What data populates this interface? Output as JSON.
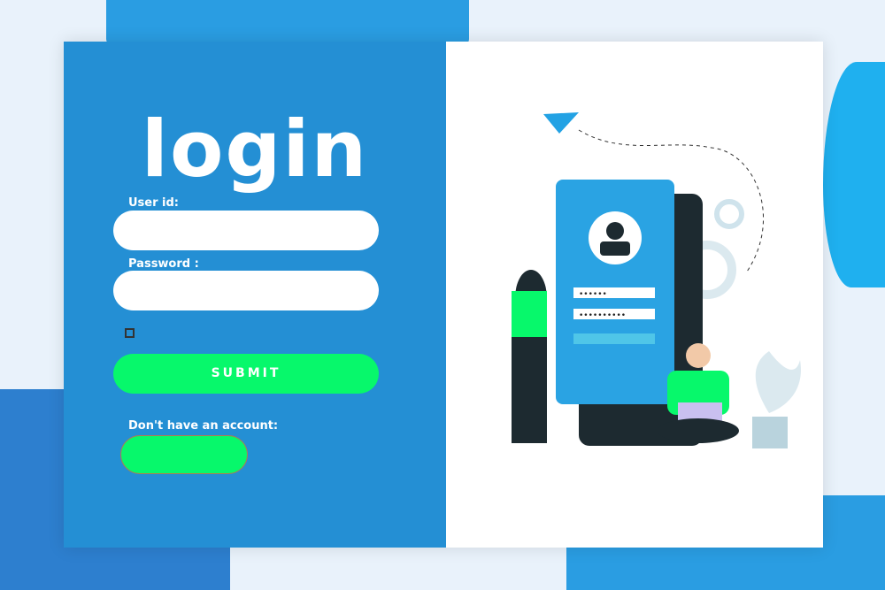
{
  "title": "login",
  "form": {
    "user_label": "User id:",
    "user_value": "",
    "password_label": "Password :",
    "password_value": "",
    "submit_label": "SUBMIT",
    "no_account_label": "Don't have an account:"
  },
  "illustration": {
    "masked_short": "••••••",
    "masked_long": "••••••••••"
  },
  "colors": {
    "panel": "#248fd4",
    "accent": "#07f86b"
  }
}
